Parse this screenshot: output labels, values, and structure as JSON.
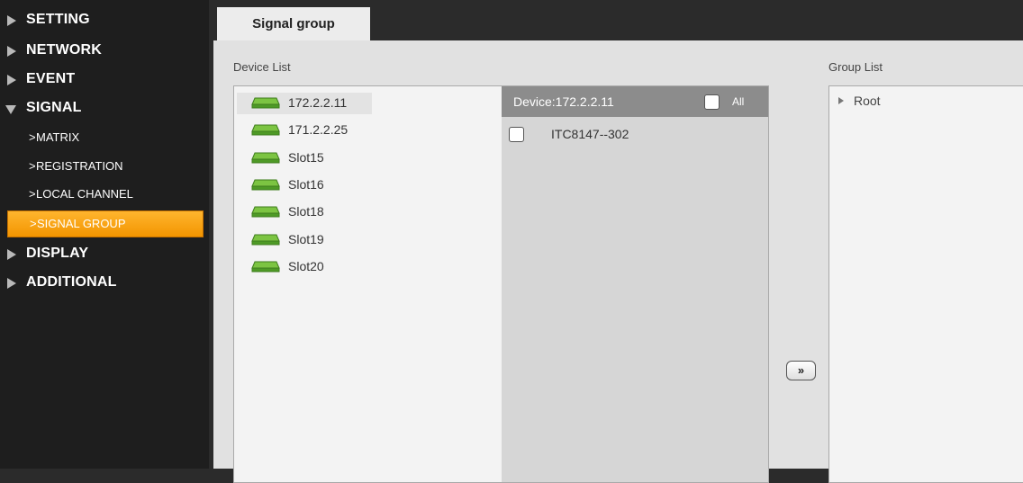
{
  "sidebar": {
    "items": [
      {
        "label": "SETTING",
        "expanded": false
      },
      {
        "label": "NETWORK",
        "expanded": false
      },
      {
        "label": "EVENT",
        "expanded": false
      },
      {
        "label": "SIGNAL",
        "expanded": true,
        "children": [
          {
            "label": "MATRIX",
            "active": false
          },
          {
            "label": "REGISTRATION",
            "active": false
          },
          {
            "label": "LOCAL CHANNEL",
            "active": false
          },
          {
            "label": "SIGNAL GROUP",
            "active": true
          }
        ]
      },
      {
        "label": "DISPLAY",
        "expanded": false
      },
      {
        "label": "ADDITIONAL",
        "expanded": false
      }
    ],
    "sub_prefix": ">"
  },
  "tab": {
    "label": "Signal group"
  },
  "device_list": {
    "label": "Device List",
    "items": [
      "172.2.2.11",
      "171.2.2.25",
      "Slot15",
      "Slot16",
      "Slot18",
      "Slot19",
      "Slot20"
    ],
    "selected_index": 0
  },
  "channels": {
    "header": "Device:172.2.2.11",
    "all_label": "All",
    "items": [
      {
        "label": "ITC8147--302",
        "checked": false
      }
    ]
  },
  "move_button": {
    "label": "»"
  },
  "group_list": {
    "label": "Group List",
    "root_label": "Root"
  },
  "colors": {
    "active_menu": "#f39500",
    "sidebar_bg": "#1e1e1e",
    "device_icon": "#5aa32a"
  },
  "icons": {
    "collapsed": "triangle-right-icon",
    "expanded": "triangle-down-icon",
    "device": "device-icon"
  }
}
